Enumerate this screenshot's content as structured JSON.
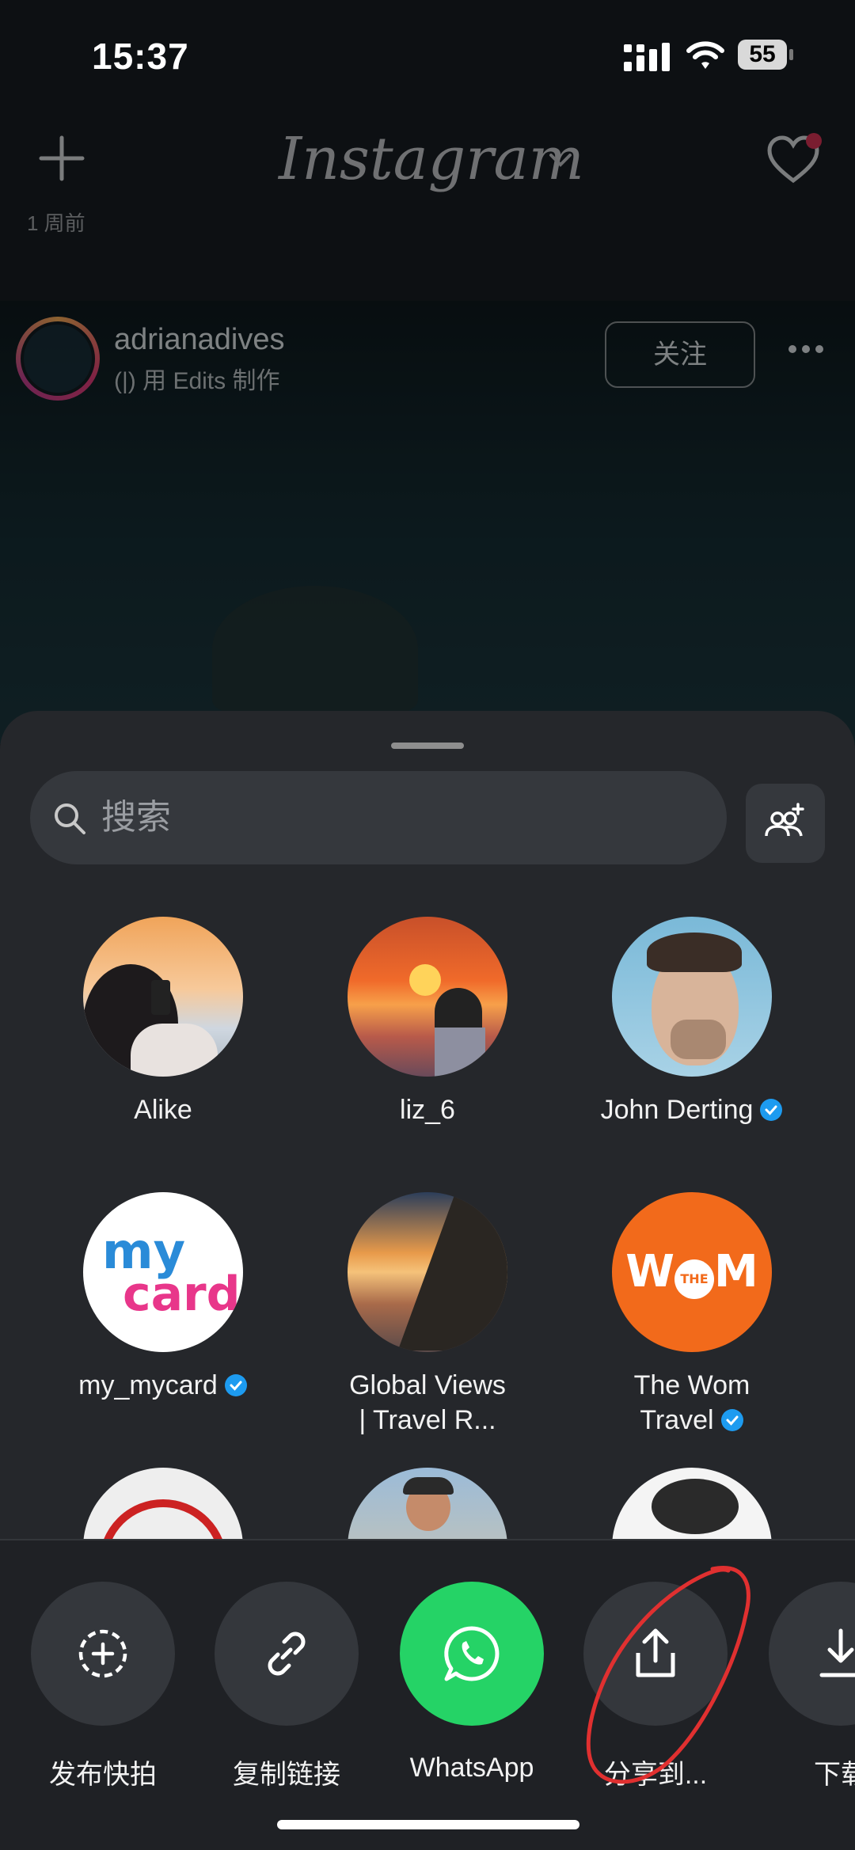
{
  "status": {
    "time": "15:37",
    "battery": "55"
  },
  "header": {
    "logo": "Instagram",
    "week_label": "1 周前"
  },
  "post": {
    "username": "adrianadives",
    "subtitle": "用 Edits 制作",
    "follow": "关注"
  },
  "share": {
    "search_placeholder": "搜索",
    "contacts": [
      {
        "name": "Alike",
        "verified": false
      },
      {
        "name": "liz_6",
        "verified": false
      },
      {
        "name": "John Derting",
        "verified": true
      },
      {
        "name": "my_mycard",
        "verified": true
      },
      {
        "name": "Global Views\n| Travel R...",
        "verified": false
      },
      {
        "name": "The Wom\nTravel",
        "verified": true
      }
    ],
    "mycard_text": {
      "line1": "my",
      "line2": "card"
    },
    "wom_text": {
      "left": "W",
      "center": "THE",
      "right": "M"
    },
    "actions": [
      {
        "label": "发布快拍",
        "icon": "add-story-icon"
      },
      {
        "label": "复制链接",
        "icon": "link-icon"
      },
      {
        "label": "WhatsApp",
        "icon": "whatsapp-icon"
      },
      {
        "label": "分享到...",
        "icon": "share-icon"
      },
      {
        "label": "下载",
        "icon": "download-icon"
      }
    ]
  },
  "colors": {
    "sheet": "#25272b",
    "whatsapp": "#25d366",
    "verified": "#1d9bf0",
    "annotation": "#e03030"
  }
}
